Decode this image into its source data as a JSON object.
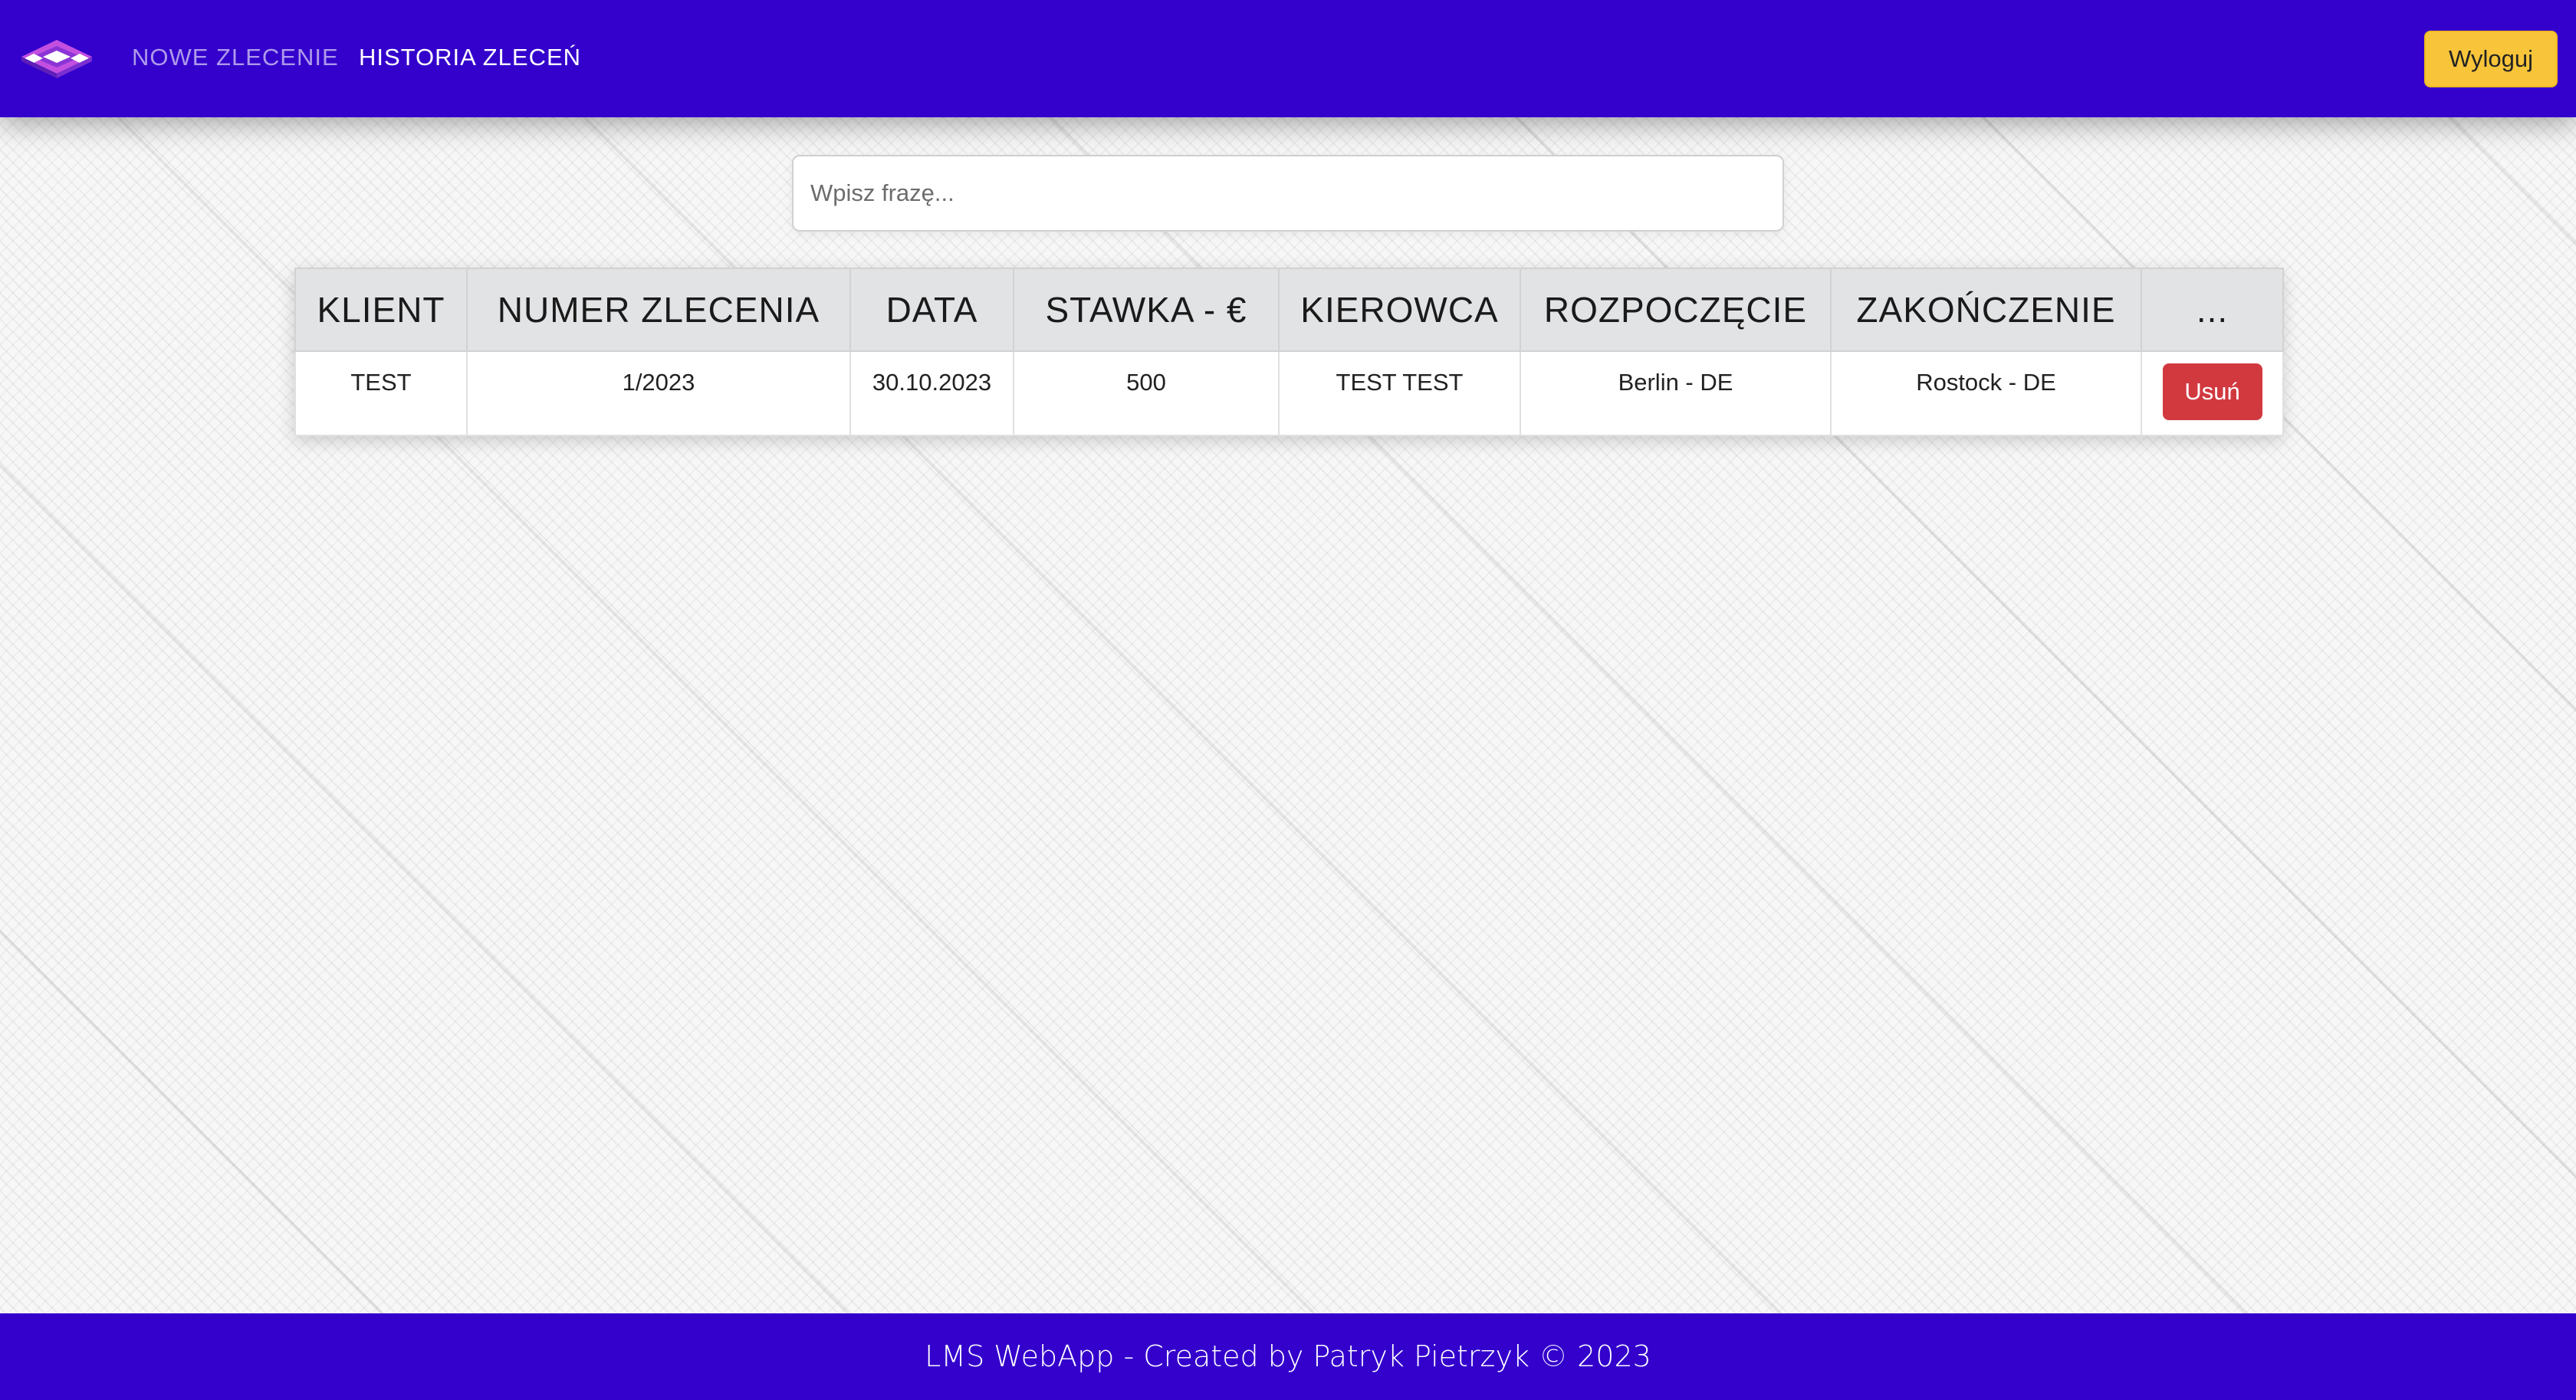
{
  "navbar": {
    "links": [
      {
        "label": "NOWE ZLECENIE"
      },
      {
        "label": "HISTORIA ZLECEŃ"
      }
    ],
    "logout_label": "Wyloguj",
    "logo_icon": "cube-logo-icon",
    "colors": {
      "background": "#3300cc",
      "logout": "#f8c53a"
    }
  },
  "search": {
    "placeholder": "Wpisz frazę...",
    "value": ""
  },
  "table": {
    "columns": [
      "KLIENT",
      "NUMER ZLECENIA",
      "DATA",
      "STAWKA - €",
      "KIEROWCA",
      "ROZPOCZĘCIE",
      "ZAKOŃCZENIE",
      "..."
    ],
    "rows": [
      {
        "klient": "TEST",
        "numer": "1/2023",
        "data": "30.10.2023",
        "stawka": "500",
        "kierowca": "TEST TEST",
        "rozpoczecie": "Berlin - DE",
        "zakonczenie": "Rostock - DE",
        "delete_label": "Usuń"
      }
    ],
    "colors": {
      "header": "#e2e3e5",
      "delete": "#d1393f"
    }
  },
  "footer": {
    "text": "LMS WebApp - Created by Patryk Pietrzyk © 2023"
  }
}
